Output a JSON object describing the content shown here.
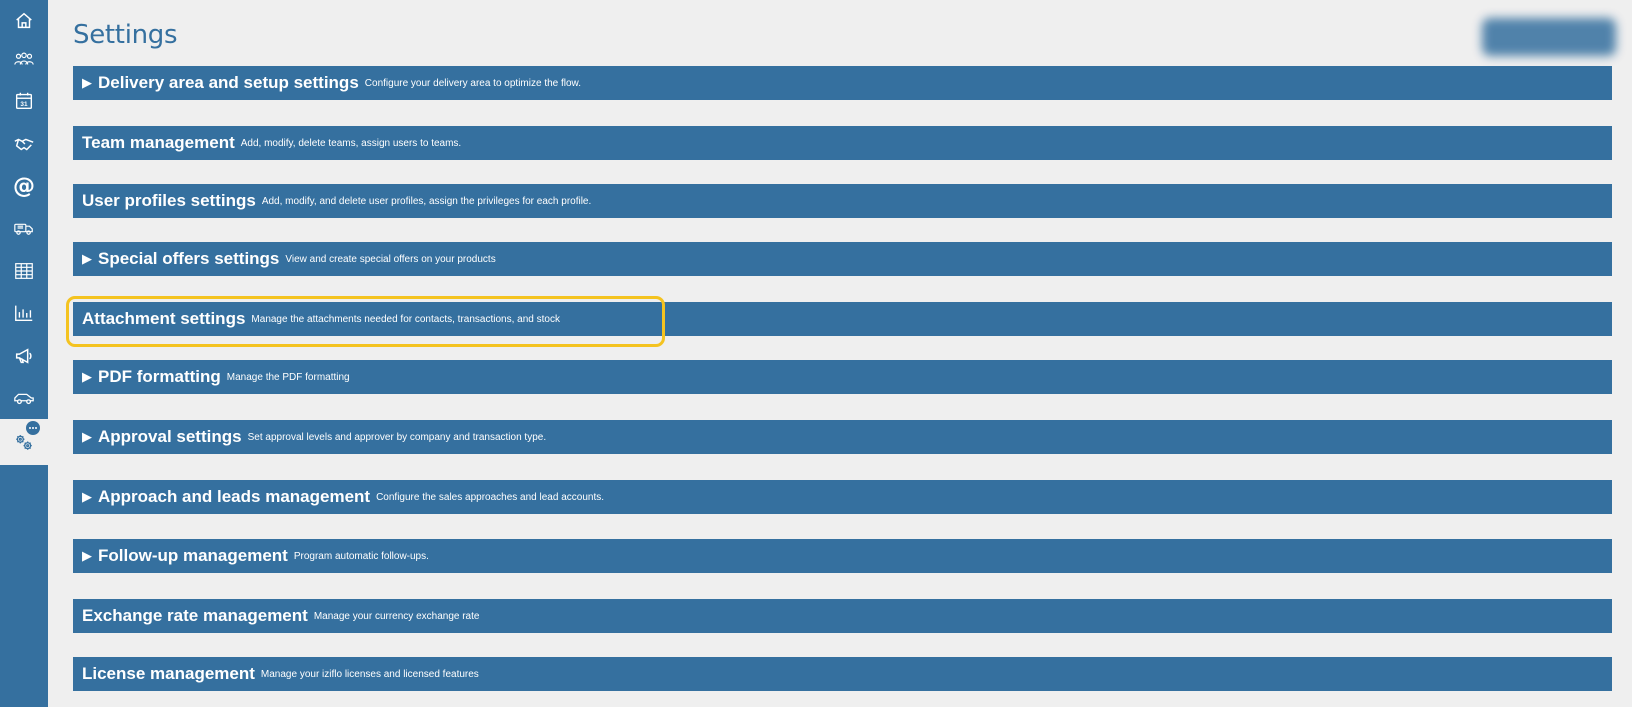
{
  "page": {
    "title": "Settings"
  },
  "sidebar": {
    "items": [
      {
        "icon": "home-icon"
      },
      {
        "icon": "people-icon"
      },
      {
        "icon": "calendar-icon",
        "label": "31"
      },
      {
        "icon": "handshake-icon"
      },
      {
        "icon": "at-sign-icon",
        "label": "@"
      },
      {
        "icon": "delivery-truck-icon"
      },
      {
        "icon": "table-icon"
      },
      {
        "icon": "bar-chart-icon"
      },
      {
        "icon": "megaphone-icon"
      },
      {
        "icon": "car-icon"
      },
      {
        "icon": "settings-gears-icon",
        "active": true
      }
    ]
  },
  "sections": [
    {
      "expandable": true,
      "arrow": "▶",
      "title": "Delivery area and setup settings",
      "description": "Configure your delivery area to optimize the flow."
    },
    {
      "expandable": false,
      "arrow": "",
      "title": "Team management",
      "description": "Add, modify, delete teams, assign users to teams."
    },
    {
      "expandable": false,
      "arrow": "",
      "title": "User profiles settings",
      "description": "Add, modify, and delete user profiles, assign the privileges for each profile."
    },
    {
      "expandable": true,
      "arrow": "▶",
      "title": "Special offers settings",
      "description": "View and create special offers on your products"
    },
    {
      "expandable": false,
      "arrow": "",
      "title": "Attachment settings",
      "description": "Manage the attachments needed for contacts, transactions, and stock",
      "highlighted": true
    },
    {
      "expandable": true,
      "arrow": "▶",
      "title": "PDF formatting",
      "description": "Manage the PDF formatting"
    },
    {
      "expandable": true,
      "arrow": "▶",
      "title": "Approval settings",
      "description": "Set approval levels and approver by company and transaction type."
    },
    {
      "expandable": true,
      "arrow": "▶",
      "title": "Approach and leads management",
      "description": "Configure the sales approaches and lead accounts."
    },
    {
      "expandable": true,
      "arrow": "▶",
      "title": "Follow-up management",
      "description": "Program automatic follow-ups."
    },
    {
      "expandable": false,
      "arrow": "",
      "title": "Exchange rate management",
      "description": "Manage your currency exchange rate"
    },
    {
      "expandable": false,
      "arrow": "",
      "title": "License management",
      "description": "Manage your iziflo licenses and licensed features"
    }
  ],
  "colors": {
    "primary": "#35709f",
    "background": "#efefef",
    "highlight": "#f4c320"
  }
}
